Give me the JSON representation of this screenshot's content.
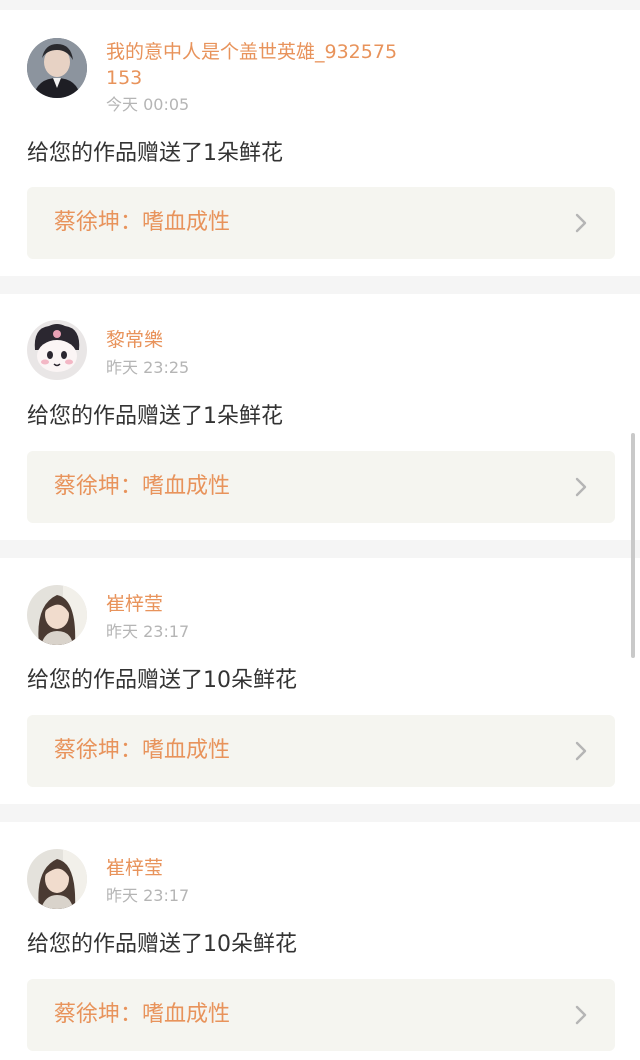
{
  "notifications": [
    {
      "username": "我的意中人是个盖世英雄_932575153",
      "time": "今天 00:05",
      "message": "给您的作品赠送了1朵鲜花",
      "work_title": "蔡徐坤：嗜血成性",
      "avatar_icon": "avatar-boy-photo"
    },
    {
      "username": "黎常樂",
      "time": "昨天 23:25",
      "message": "给您的作品赠送了1朵鲜花",
      "work_title": "蔡徐坤：嗜血成性",
      "avatar_icon": "avatar-kuromi-plush"
    },
    {
      "username": "崔梓莹",
      "time": "昨天 23:17",
      "message": "给您的作品赠送了10朵鲜花",
      "work_title": "蔡徐坤：嗜血成性",
      "avatar_icon": "avatar-girl-photo"
    },
    {
      "username": "崔梓莹",
      "time": "昨天 23:17",
      "message": "给您的作品赠送了10朵鲜花",
      "work_title": "蔡徐坤：嗜血成性",
      "avatar_icon": "avatar-girl-photo"
    }
  ],
  "colors": {
    "accent": "#e8935b",
    "page_bg": "#f5f5f5",
    "card_bg": "#ffffff",
    "link_bg": "#f5f5f0",
    "text": "#333333",
    "muted": "#b5b5b5"
  }
}
